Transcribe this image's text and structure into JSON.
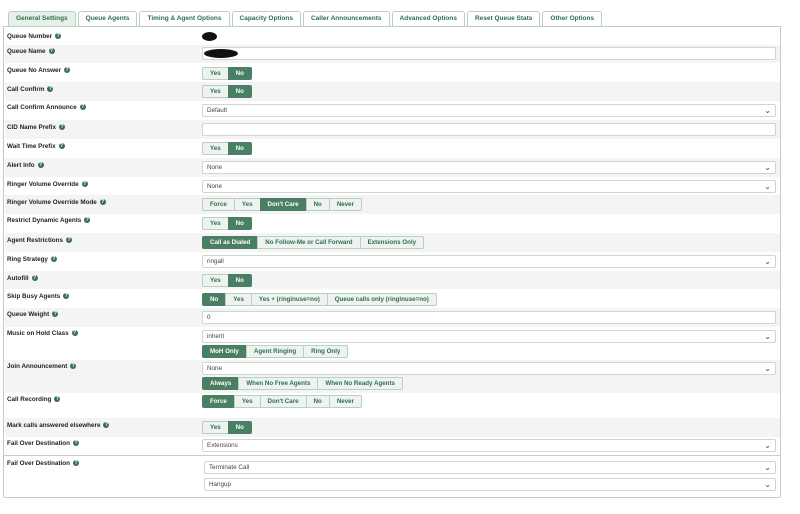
{
  "tabs": [
    {
      "label": "General Settings",
      "active": true
    },
    {
      "label": "Queue Agents"
    },
    {
      "label": "Timing & Agent Options"
    },
    {
      "label": "Capacity Options"
    },
    {
      "label": "Caller Announcements"
    },
    {
      "label": "Advanced Options"
    },
    {
      "label": "Reset Queue Stats"
    },
    {
      "label": "Other Options"
    }
  ],
  "help_glyph": "?",
  "chevron_glyph": "⌄",
  "fields": {
    "queue_number": {
      "label": "Queue Number"
    },
    "queue_name": {
      "label": "Queue Name"
    },
    "queue_no_answer": {
      "label": "Queue No Answer",
      "options": [
        "Yes",
        "No"
      ],
      "selected": "No"
    },
    "call_confirm": {
      "label": "Call Confirm",
      "options": [
        "Yes",
        "No"
      ],
      "selected": "No"
    },
    "call_confirm_announce": {
      "label": "Call Confirm Announce",
      "value": "Default"
    },
    "cid_name_prefix": {
      "label": "CID Name Prefix",
      "value": ""
    },
    "wait_time_prefix": {
      "label": "Wait Time Prefix",
      "options": [
        "Yes",
        "No"
      ],
      "selected": "No"
    },
    "alert_info": {
      "label": "Alert Info",
      "value": "None"
    },
    "ringer_volume_override": {
      "label": "Ringer Volume Override",
      "value": "None"
    },
    "ringer_volume_override_mode": {
      "label": "Ringer Volume Override Mode",
      "options": [
        "Force",
        "Yes",
        "Don't Care",
        "No",
        "Never"
      ],
      "selected": "Don't Care"
    },
    "restrict_dynamic_agents": {
      "label": "Restrict Dynamic Agents",
      "options": [
        "Yes",
        "No"
      ],
      "selected": "No"
    },
    "agent_restrictions": {
      "label": "Agent Restrictions",
      "options": [
        "Call as Dialed",
        "No Follow-Me or Call Forward",
        "Extensions Only"
      ],
      "selected": "Call as Dialed"
    },
    "ring_strategy": {
      "label": "Ring Strategy",
      "value": "ringall"
    },
    "autofill": {
      "label": "Autofill",
      "options": [
        "Yes",
        "No"
      ],
      "selected": "No"
    },
    "skip_busy_agents": {
      "label": "Skip Busy Agents",
      "options": [
        "No",
        "Yes",
        "Yes + (ringinuse=no)",
        "Queue calls only (ringinuse=no)"
      ],
      "selected": "No"
    },
    "queue_weight": {
      "label": "Queue Weight",
      "value": "0"
    },
    "music_on_hold_class": {
      "label": "Music on Hold Class",
      "value": "inherit",
      "options": [
        "MoH Only",
        "Agent Ringing",
        "Ring Only"
      ],
      "selected": "MoH Only"
    },
    "join_announcement": {
      "label": "Join Announcement",
      "value": "None",
      "options": [
        "Always",
        "When No Free Agents",
        "When No Ready Agents"
      ],
      "selected": "Always"
    },
    "call_recording": {
      "label": "Call Recording",
      "options": [
        "Force",
        "Yes",
        "Don't Care",
        "No",
        "Never"
      ],
      "selected": "Force"
    },
    "mark_calls": {
      "label": "Mark calls answered elsewhere",
      "options": [
        "Yes",
        "No"
      ],
      "selected": "No"
    },
    "fail_over_destination": {
      "label": "Fail Over Destination",
      "value": "Extensions"
    },
    "fail_over_destination_2": {
      "label": "Fail Over Destination",
      "value": "Terminate Call",
      "value2": "Hangup"
    }
  },
  "colors": {
    "accent": "#4a7f63",
    "tab_text": "#2e6e4e"
  }
}
